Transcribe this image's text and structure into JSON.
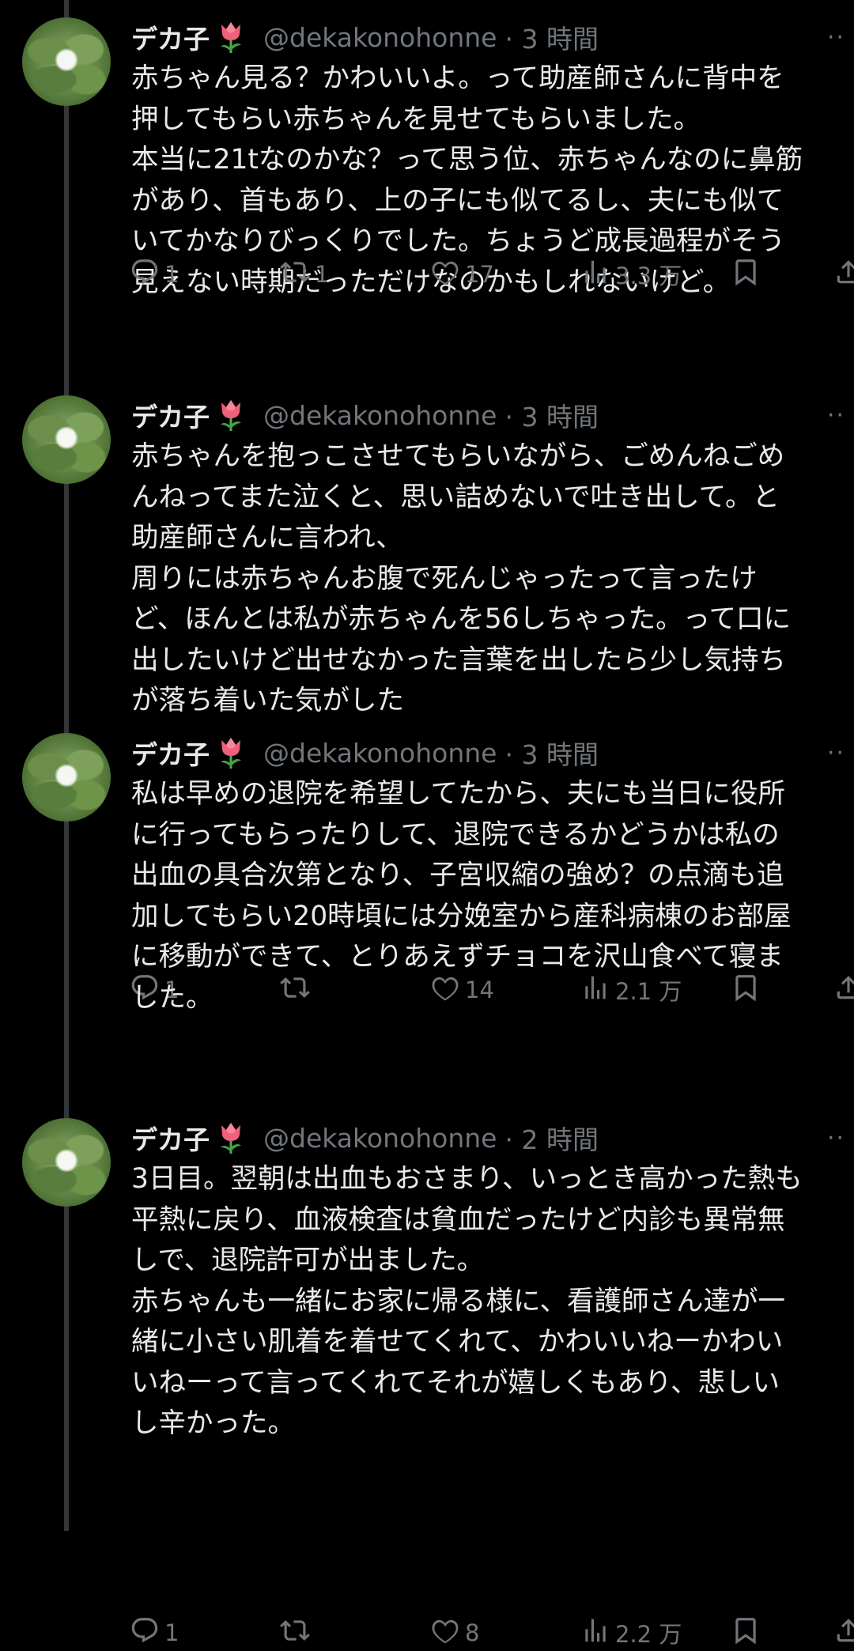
{
  "tweets": [
    {
      "author": "デカ子",
      "handle": "@dekakonohonne",
      "time": "· 3 時間",
      "lines": [
        "赤ちゃん見る？かわいいよ。って助産師さんに背中を",
        "押してもらい赤ちゃんを見せてもらいました。",
        "本当に21tなのかな？って思う位、赤ちゃんなのに鼻筋",
        "があり、首もあり、上の子にも似てるし、夫にも似て",
        "いてかなりびっくりでした。ちょうど成長過程がそう",
        "見えない時期だっただけなのかもしれないけど。"
      ],
      "replies": "1",
      "retweets": "1",
      "likes": "17",
      "views": "3.3 万"
    },
    {
      "author": "デカ子",
      "handle": "@dekakonohonne",
      "time": "· 3 時間",
      "lines": [
        "赤ちゃんを抱っこさせてもらいながら、ごめんねごめ",
        "んねってまた泣くと、思い詰めないで吐き出して。と",
        "助産師さんに言われ、",
        "周りには赤ちゃんお腹で死んじゃったって言ったけ",
        "ど、ほんとは私が赤ちゃんを56しちゃった。って口に",
        "出したいけど出せなかった言葉を出したら少し気持ち",
        "が落ち着いた気がした"
      ],
      "replies": "1",
      "retweets": "",
      "likes": "14",
      "views": "2.1 万"
    },
    {
      "author": "デカ子",
      "handle": "@dekakonohonne",
      "time": "· 3 時間",
      "lines": [
        "私は早めの退院を希望してたから、夫にも当日に役所",
        "に行ってもらったりして、退院できるかどうかは私の",
        "出血の具合次第となり、子宮収縮の強め？の点滴も追",
        "加してもらい20時頃には分娩室から産科病棟のお部屋",
        "に移動ができて、とりあえずチョコを沢山食べて寝ま",
        "した。"
      ],
      "replies": "1",
      "retweets": "",
      "likes": "8",
      "views": "2.2 万"
    },
    {
      "author": "デカ子",
      "handle": "@dekakonohonne",
      "time": "· 2 時間",
      "lines": [
        "3日目。翌朝は出血もおさまり、いっとき高かった熱も",
        "平熱に戻り、血液検査は貧血だったけど内診も異常無",
        "しで、退院許可が出ました。",
        "赤ちゃんも一緒にお家に帰る様に、看護師さん達が一",
        "緒に小さい肌着を着せてくれて、かわいいねーかわい",
        "いねーって言ってくれてそれが嬉しくもあり、悲しい",
        "し辛かった。"
      ]
    }
  ],
  "icons": {
    "avatar": "white-flower-leaves-avatar",
    "emoji": "tulip-icon",
    "more": "more-icon",
    "reply": "reply-icon",
    "retweet": "retweet-icon",
    "like": "heart-icon",
    "views": "views-icon",
    "bookmark": "bookmark-icon",
    "share": "share-icon"
  },
  "colors": {
    "background": "#000000",
    "text": "#e7e9ea",
    "muted": "#71767b",
    "thread_line": "#333639",
    "tulip": "#f0607a"
  }
}
